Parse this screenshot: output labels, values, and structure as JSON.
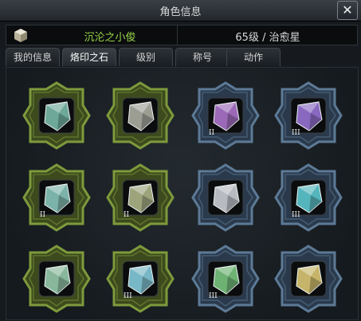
{
  "window": {
    "title": "角色信息",
    "close_label": "✕"
  },
  "character": {
    "name": "沉沦之小俊",
    "level_class": "65级 / 治愈星"
  },
  "tabs": [
    {
      "label": "我的信息"
    },
    {
      "label": "烙印之石"
    },
    {
      "label": "级别"
    },
    {
      "label": "称号"
    },
    {
      "label": "动作"
    }
  ],
  "active_tab": 1,
  "colors": {
    "name": "#9ad848",
    "frame_green": "#7e9a3c",
    "frame_blue": "#5d7a96"
  },
  "slots": [
    {
      "frame": "green",
      "gem": "teal-gem-icon",
      "gem_color": "#7fc4b2",
      "level": ""
    },
    {
      "frame": "green",
      "gem": "silver-gem-icon",
      "gem_color": "#b6b9ad",
      "level": ""
    },
    {
      "frame": "blue",
      "gem": "purple-rune-gem-icon",
      "gem_color": "#b57ad6",
      "level": "II"
    },
    {
      "frame": "blue",
      "gem": "violet-gem-icon",
      "gem_color": "#a07ae0",
      "level": "III"
    },
    {
      "frame": "green",
      "gem": "teal-gem-icon",
      "gem_color": "#8fd0c6",
      "level": "II"
    },
    {
      "frame": "green",
      "gem": "olive-gem-icon",
      "gem_color": "#b7c091",
      "level": "II"
    },
    {
      "frame": "blue",
      "gem": "white-gem-icon",
      "gem_color": "#d6d9e0",
      "level": ""
    },
    {
      "frame": "blue",
      "gem": "cyan-gem-icon",
      "gem_color": "#63d3dc",
      "level": "III"
    },
    {
      "frame": "green",
      "gem": "jade-gem-icon",
      "gem_color": "#9fd6b6",
      "level": ""
    },
    {
      "frame": "green",
      "gem": "aqua-gem-icon",
      "gem_color": "#8cd6e6",
      "level": "III"
    },
    {
      "frame": "blue",
      "gem": "green-gem-icon",
      "gem_color": "#7fcf86",
      "level": "III"
    },
    {
      "frame": "blue",
      "gem": "gold-gem-icon",
      "gem_color": "#e6d27a",
      "level": ""
    }
  ]
}
